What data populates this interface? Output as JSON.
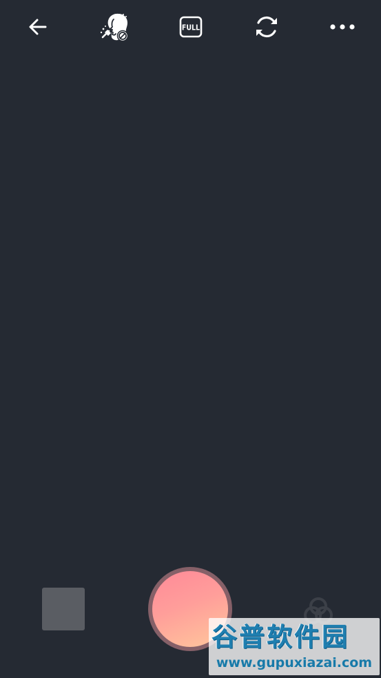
{
  "toolbar": {
    "back": {
      "icon": "arrow-left-icon"
    },
    "beauty": {
      "icon": "face-retouch-off-icon"
    },
    "aspect": {
      "label": "FULL",
      "icon": "full-ratio-icon"
    },
    "switch_camera": {
      "icon": "camera-switch-icon"
    },
    "more": {
      "icon": "more-horizontal-icon"
    }
  },
  "bottom": {
    "gallery": {
      "icon": "gallery-thumbnail"
    },
    "shutter": {
      "icon": "shutter-button",
      "color_start": "#ff8a98",
      "color_end": "#ffc79c",
      "ring_color": "#866068"
    },
    "filter": {
      "icon": "filter-icon"
    }
  },
  "watermark": {
    "title": "谷普软件园",
    "url": "www.gupuxiazai.com"
  },
  "colors": {
    "background": "#252a33",
    "icon": "#ffffff"
  }
}
